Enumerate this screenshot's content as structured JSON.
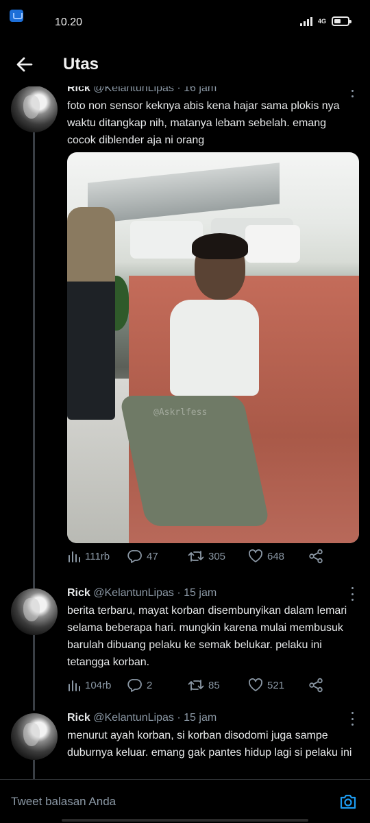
{
  "status_bar": {
    "time": "10.20",
    "network": "4G",
    "app_icon": "twitter-notification-icon"
  },
  "header": {
    "title": "Utas",
    "back_icon": "arrow-left-icon"
  },
  "tweets": [
    {
      "name": "Rick",
      "handle": "@KelantunLipas",
      "separator": "·",
      "time": "16 jam",
      "text": "foto non sensor keknya abis kena hajar sama plokis nya waktu ditangkap nih, matanya lebam sebelah. emang cocok diblender aja ni orang",
      "media_watermark": "@Askrlfess",
      "stats": {
        "views": "111rb",
        "replies": "47",
        "retweets": "305",
        "likes": "648"
      }
    },
    {
      "name": "Rick",
      "handle": "@KelantunLipas",
      "separator": "·",
      "time": "15 jam",
      "text": "berita terbaru, mayat korban disembunyikan dalam lemari selama beberapa hari. mungkin karena mulai membusuk barulah dibuang pelaku ke semak belukar. pelaku ini tetangga korban.",
      "stats": {
        "views": "104rb",
        "replies": "2",
        "retweets": "85",
        "likes": "521"
      }
    },
    {
      "name": "Rick",
      "handle": "@KelantunLipas",
      "separator": "·",
      "time": "15 jam",
      "text": "menurut ayah korban, si korban disodomi juga sampe duburnya keluar. emang gak pantes hidup lagi si pelaku ini"
    }
  ],
  "reply_bar": {
    "placeholder": "Tweet balasan Anda",
    "camera_icon": "camera-icon"
  },
  "colors": {
    "background": "#000000",
    "text": "#e7e9ea",
    "secondary": "#8b98a5",
    "accent": "#1d9bf0",
    "thread_line": "#3a3f45"
  }
}
